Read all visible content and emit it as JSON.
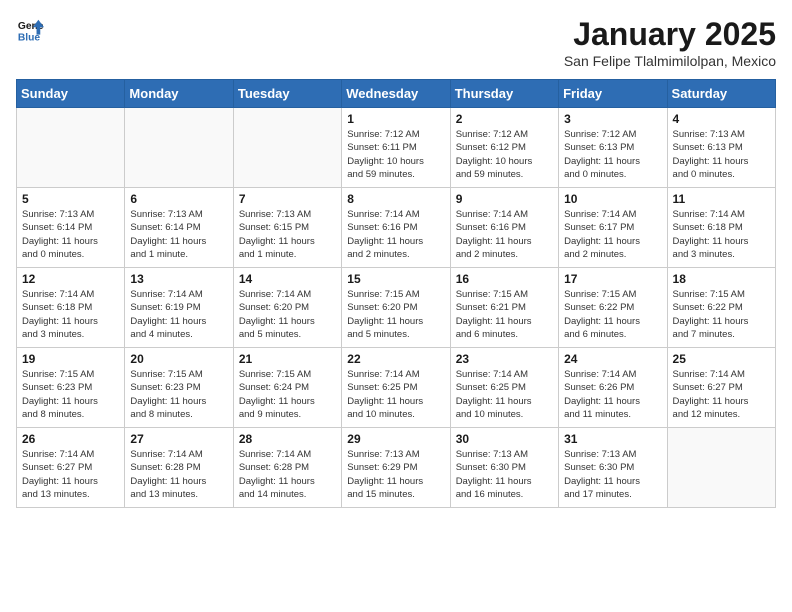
{
  "header": {
    "logo_line1": "General",
    "logo_line2": "Blue",
    "title": "January 2025",
    "subtitle": "San Felipe Tlalmimilolpan, Mexico"
  },
  "days_of_week": [
    "Sunday",
    "Monday",
    "Tuesday",
    "Wednesday",
    "Thursday",
    "Friday",
    "Saturday"
  ],
  "weeks": [
    [
      {
        "day": "",
        "info": ""
      },
      {
        "day": "",
        "info": ""
      },
      {
        "day": "",
        "info": ""
      },
      {
        "day": "1",
        "info": "Sunrise: 7:12 AM\nSunset: 6:11 PM\nDaylight: 10 hours\nand 59 minutes."
      },
      {
        "day": "2",
        "info": "Sunrise: 7:12 AM\nSunset: 6:12 PM\nDaylight: 10 hours\nand 59 minutes."
      },
      {
        "day": "3",
        "info": "Sunrise: 7:12 AM\nSunset: 6:13 PM\nDaylight: 11 hours\nand 0 minutes."
      },
      {
        "day": "4",
        "info": "Sunrise: 7:13 AM\nSunset: 6:13 PM\nDaylight: 11 hours\nand 0 minutes."
      }
    ],
    [
      {
        "day": "5",
        "info": "Sunrise: 7:13 AM\nSunset: 6:14 PM\nDaylight: 11 hours\nand 0 minutes."
      },
      {
        "day": "6",
        "info": "Sunrise: 7:13 AM\nSunset: 6:14 PM\nDaylight: 11 hours\nand 1 minute."
      },
      {
        "day": "7",
        "info": "Sunrise: 7:13 AM\nSunset: 6:15 PM\nDaylight: 11 hours\nand 1 minute."
      },
      {
        "day": "8",
        "info": "Sunrise: 7:14 AM\nSunset: 6:16 PM\nDaylight: 11 hours\nand 2 minutes."
      },
      {
        "day": "9",
        "info": "Sunrise: 7:14 AM\nSunset: 6:16 PM\nDaylight: 11 hours\nand 2 minutes."
      },
      {
        "day": "10",
        "info": "Sunrise: 7:14 AM\nSunset: 6:17 PM\nDaylight: 11 hours\nand 2 minutes."
      },
      {
        "day": "11",
        "info": "Sunrise: 7:14 AM\nSunset: 6:18 PM\nDaylight: 11 hours\nand 3 minutes."
      }
    ],
    [
      {
        "day": "12",
        "info": "Sunrise: 7:14 AM\nSunset: 6:18 PM\nDaylight: 11 hours\nand 3 minutes."
      },
      {
        "day": "13",
        "info": "Sunrise: 7:14 AM\nSunset: 6:19 PM\nDaylight: 11 hours\nand 4 minutes."
      },
      {
        "day": "14",
        "info": "Sunrise: 7:14 AM\nSunset: 6:20 PM\nDaylight: 11 hours\nand 5 minutes."
      },
      {
        "day": "15",
        "info": "Sunrise: 7:15 AM\nSunset: 6:20 PM\nDaylight: 11 hours\nand 5 minutes."
      },
      {
        "day": "16",
        "info": "Sunrise: 7:15 AM\nSunset: 6:21 PM\nDaylight: 11 hours\nand 6 minutes."
      },
      {
        "day": "17",
        "info": "Sunrise: 7:15 AM\nSunset: 6:22 PM\nDaylight: 11 hours\nand 6 minutes."
      },
      {
        "day": "18",
        "info": "Sunrise: 7:15 AM\nSunset: 6:22 PM\nDaylight: 11 hours\nand 7 minutes."
      }
    ],
    [
      {
        "day": "19",
        "info": "Sunrise: 7:15 AM\nSunset: 6:23 PM\nDaylight: 11 hours\nand 8 minutes."
      },
      {
        "day": "20",
        "info": "Sunrise: 7:15 AM\nSunset: 6:23 PM\nDaylight: 11 hours\nand 8 minutes."
      },
      {
        "day": "21",
        "info": "Sunrise: 7:15 AM\nSunset: 6:24 PM\nDaylight: 11 hours\nand 9 minutes."
      },
      {
        "day": "22",
        "info": "Sunrise: 7:14 AM\nSunset: 6:25 PM\nDaylight: 11 hours\nand 10 minutes."
      },
      {
        "day": "23",
        "info": "Sunrise: 7:14 AM\nSunset: 6:25 PM\nDaylight: 11 hours\nand 10 minutes."
      },
      {
        "day": "24",
        "info": "Sunrise: 7:14 AM\nSunset: 6:26 PM\nDaylight: 11 hours\nand 11 minutes."
      },
      {
        "day": "25",
        "info": "Sunrise: 7:14 AM\nSunset: 6:27 PM\nDaylight: 11 hours\nand 12 minutes."
      }
    ],
    [
      {
        "day": "26",
        "info": "Sunrise: 7:14 AM\nSunset: 6:27 PM\nDaylight: 11 hours\nand 13 minutes."
      },
      {
        "day": "27",
        "info": "Sunrise: 7:14 AM\nSunset: 6:28 PM\nDaylight: 11 hours\nand 13 minutes."
      },
      {
        "day": "28",
        "info": "Sunrise: 7:14 AM\nSunset: 6:28 PM\nDaylight: 11 hours\nand 14 minutes."
      },
      {
        "day": "29",
        "info": "Sunrise: 7:13 AM\nSunset: 6:29 PM\nDaylight: 11 hours\nand 15 minutes."
      },
      {
        "day": "30",
        "info": "Sunrise: 7:13 AM\nSunset: 6:30 PM\nDaylight: 11 hours\nand 16 minutes."
      },
      {
        "day": "31",
        "info": "Sunrise: 7:13 AM\nSunset: 6:30 PM\nDaylight: 11 hours\nand 17 minutes."
      },
      {
        "day": "",
        "info": ""
      }
    ]
  ]
}
